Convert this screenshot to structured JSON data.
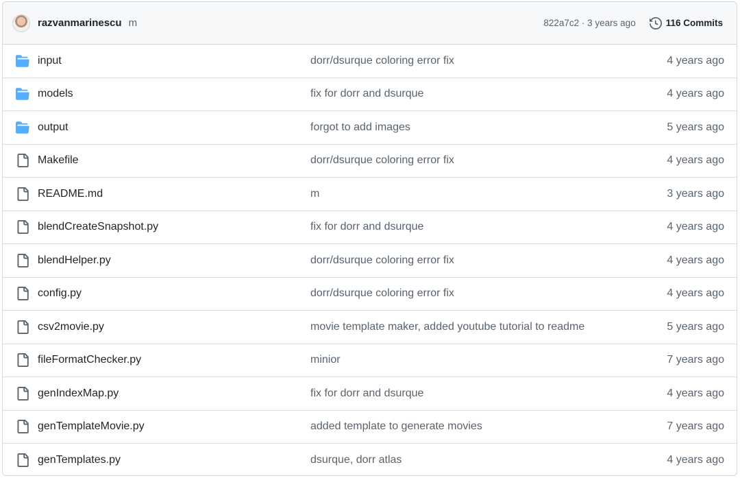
{
  "commit": {
    "author": "razvanmarinescu",
    "message": "m",
    "meta": "822a7c2 · 3 years ago",
    "commits_label": "116 Commits"
  },
  "icons": {
    "header_avatar": "avatar",
    "history": "history-icon",
    "folder": "folder-icon",
    "file": "file-icon"
  },
  "colors": {
    "folder": "#54aeff",
    "file": "#59636e",
    "muted_text": "#59636e",
    "header_bg": "#f6f8fa",
    "border": "#d0d7de"
  },
  "files": [
    {
      "type": "folder",
      "name": "input",
      "message": "dorr/dsurque coloring error fix",
      "age": "4 years ago"
    },
    {
      "type": "folder",
      "name": "models",
      "message": "fix for dorr and dsurque",
      "age": "4 years ago"
    },
    {
      "type": "folder",
      "name": "output",
      "message": "forgot to add images",
      "age": "5 years ago"
    },
    {
      "type": "file",
      "name": "Makefile",
      "message": "dorr/dsurque coloring error fix",
      "age": "4 years ago"
    },
    {
      "type": "file",
      "name": "README.md",
      "message": "m",
      "age": "3 years ago"
    },
    {
      "type": "file",
      "name": "blendCreateSnapshot.py",
      "message": "fix for dorr and dsurque",
      "age": "4 years ago"
    },
    {
      "type": "file",
      "name": "blendHelper.py",
      "message": "dorr/dsurque coloring error fix",
      "age": "4 years ago"
    },
    {
      "type": "file",
      "name": "config.py",
      "message": "dorr/dsurque coloring error fix",
      "age": "4 years ago"
    },
    {
      "type": "file",
      "name": "csv2movie.py",
      "message": "movie template maker, added youtube tutorial to readme",
      "age": "5 years ago"
    },
    {
      "type": "file",
      "name": "fileFormatChecker.py",
      "message": "minior",
      "age": "7 years ago"
    },
    {
      "type": "file",
      "name": "genIndexMap.py",
      "message": "fix for dorr and dsurque",
      "age": "4 years ago"
    },
    {
      "type": "file",
      "name": "genTemplateMovie.py",
      "message": "added template to generate movies",
      "age": "7 years ago"
    },
    {
      "type": "file",
      "name": "genTemplates.py",
      "message": "dsurque, dorr atlas",
      "age": "4 years ago"
    }
  ]
}
